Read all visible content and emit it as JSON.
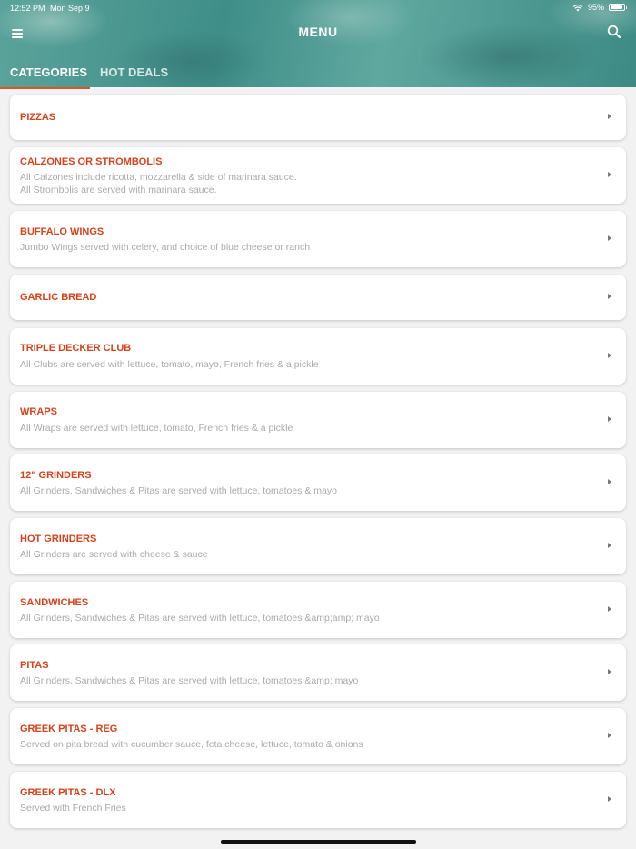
{
  "status_bar": {
    "time": "12:52 PM",
    "date": "Mon Sep 9",
    "battery": "95%",
    "battery_level": 0.95
  },
  "header": {
    "title": "MENU",
    "menu_icon": "hamburger-icon",
    "search_icon": "search-icon"
  },
  "tabs": [
    {
      "label": "CATEGORIES",
      "active": true
    },
    {
      "label": "HOT DEALS",
      "active": false
    }
  ],
  "colors": {
    "accent": "#e4531f",
    "title_red": "#d9421a",
    "header_teal": "#4a9a93"
  },
  "categories": [
    {
      "title": "PIZZAS",
      "description": ""
    },
    {
      "title": "CALZONES OR STROMBOLIS",
      "description": "All Calzones include ricotta, mozzarella & side of marinara sauce.\nAll Strombolis are served with marinara sauce."
    },
    {
      "title": "BUFFALO WINGS",
      "description": "Jumbo Wings served with celery, and choice of blue cheese or ranch"
    },
    {
      "title": "GARLIC BREAD",
      "description": ""
    },
    {
      "title": "TRIPLE DECKER CLUB",
      "description": "All Clubs are served with lettuce, tomato, mayo, French fries & a pickle"
    },
    {
      "title": "WRAPS",
      "description": "All Wraps are served with lettuce, tomato, French fries & a pickle"
    },
    {
      "title": "12\" GRINDERS",
      "description": "All Grinders, Sandwiches & Pitas are served with lettuce, tomatoes & mayo"
    },
    {
      "title": "HOT GRINDERS",
      "description": "All Grinders are served with cheese & sauce"
    },
    {
      "title": "SANDWICHES",
      "description": "All Grinders, Sandwiches & Pitas are served with lettuce, tomatoes &amp;amp; mayo"
    },
    {
      "title": "PITAS",
      "description": "All Grinders, Sandwiches & Pitas are served with lettuce, tomatoes &amp; mayo"
    },
    {
      "title": "GREEK PITAS - REG",
      "description": "Served on pita bread with cucumber sauce, feta cheese, lettuce, tomato & onions"
    },
    {
      "title": "GREEK PITAS - DLX",
      "description": "Served with French Fries"
    }
  ]
}
